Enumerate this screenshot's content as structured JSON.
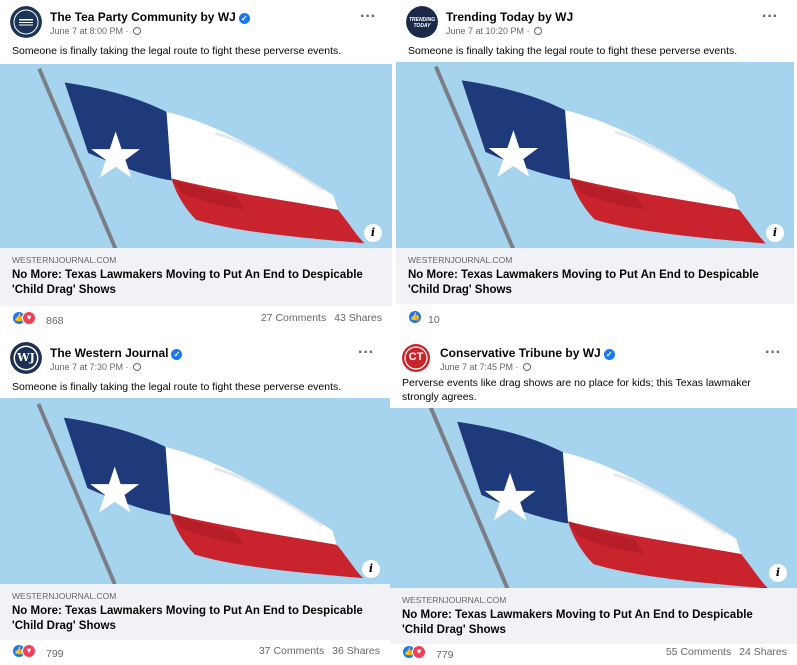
{
  "posts": [
    {
      "page_name": "The Tea Party Community by WJ",
      "verified": true,
      "timestamp": "June 7 at 8:00 PM",
      "text": "Someone is finally taking the legal route to fight these perverse events.",
      "link_domain": "WESTERNJOURNAL.COM",
      "link_title": "No More: Texas Lawmakers Moving to Put An End to Despicable 'Child Drag' Shows",
      "reaction_count": "868",
      "reactions": [
        "like",
        "love"
      ],
      "comments": "27 Comments",
      "shares": "43 Shares",
      "avatar_icon": "tea-party-community-logo-icon"
    },
    {
      "page_name": "Trending Today by WJ",
      "verified": false,
      "timestamp": "June 7 at 10:20 PM",
      "text": "Someone is finally taking the legal route to fight these perverse events.",
      "link_domain": "WESTERNJOURNAL.COM",
      "link_title": "No More: Texas Lawmakers Moving to Put An End to Despicable 'Child Drag' Shows",
      "reaction_count": "10",
      "reactions": [
        "like"
      ],
      "comments": "",
      "shares": "",
      "avatar_icon": "trending-today-logo-icon",
      "avatar_text": "TRENDING TODAY"
    },
    {
      "page_name": "The Western Journal",
      "verified": true,
      "timestamp": "June 7 at 7:30 PM",
      "text": "Someone is finally taking the legal route to fight these perverse events.",
      "link_domain": "WESTERNJOURNAL.COM",
      "link_title": "No More: Texas Lawmakers Moving to Put An End to Despicable 'Child Drag' Shows",
      "reaction_count": "799",
      "reactions": [
        "like",
        "love"
      ],
      "comments": "37 Comments",
      "shares": "36 Shares",
      "avatar_icon": "western-journal-logo-icon",
      "avatar_text": "WJ"
    },
    {
      "page_name": "Conservative Tribune by WJ",
      "verified": true,
      "timestamp": "June 7 at 7:45 PM",
      "text": "Perverse events like drag shows are no place for kids; this Texas lawmaker strongly agrees.",
      "link_domain": "WESTERNJOURNAL.COM",
      "link_title": "No More: Texas Lawmakers Moving to Put An End to Despicable 'Child Drag' Shows",
      "reaction_count": "779",
      "reactions": [
        "like",
        "love"
      ],
      "comments": "55 Comments",
      "shares": "24 Shares",
      "avatar_icon": "conservative-tribune-logo-icon",
      "avatar_text": "CT"
    }
  ],
  "colors": {
    "facebook_blue": "#1877f2",
    "love_red": "#f33e58",
    "secondary_text": "#65676b",
    "link_bg": "#f0f2f5",
    "sky": "#a9d6ef",
    "flag_blue": "#1f3a7a",
    "flag_red": "#c9232d"
  }
}
